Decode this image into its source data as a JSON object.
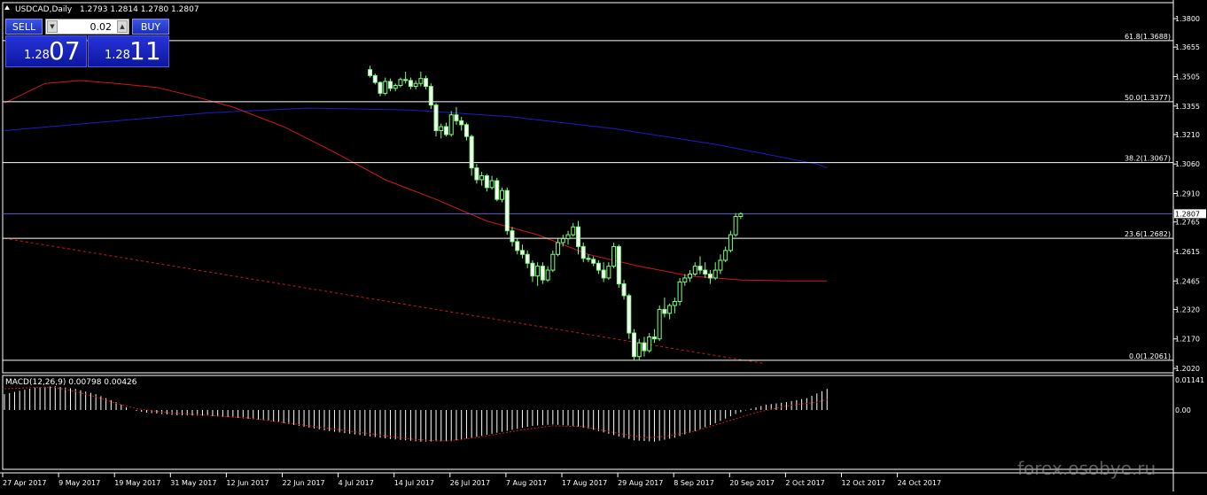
{
  "header": {
    "symbol": "USDCAD,Daily",
    "ohlc": "1.2793 1.2814 1.2780 1.2807"
  },
  "trade_panel": {
    "sell_label": "SELL",
    "buy_label": "BUY",
    "lot": "0.02",
    "sell_prefix": "1.28",
    "sell_big": "07",
    "buy_prefix": "1.28",
    "buy_big": "11"
  },
  "colors": {
    "background": "#000000",
    "candle": "#7fff7f",
    "ma_fast": "#d01818",
    "ma_slow": "#1c1cc8",
    "fib": "#ffffff",
    "bid_line": "#5c5cc8",
    "macd_hist": "#ffffff",
    "macd_signal": "#d01818",
    "bid_label_bg": "#ffffff",
    "watermark": "#9a9a9a"
  },
  "watermark": "forex.osobye.ru",
  "chart_data": [
    {
      "type": "candlestick",
      "title": "USDCAD,Daily",
      "y_ticks": [
        "1.3800",
        "1.3655",
        "1.3505",
        "1.3355",
        "1.3210",
        "1.3060",
        "1.2910",
        "1.2765",
        "1.2615",
        "1.2465",
        "1.2320",
        "1.2170",
        "1.2020"
      ],
      "ylim": [
        1.202,
        1.38
      ],
      "x_tick_labels": [
        "27 Apr 2017",
        "9 May 2017",
        "19 May 2017",
        "31 May 2017",
        "12 Jun 2017",
        "22 Jun 2017",
        "4 Jul 2017",
        "14 Jul 2017",
        "26 Jul 2017",
        "7 Aug 2017",
        "17 Aug 2017",
        "29 Aug 2017",
        "8 Sep 2017",
        "20 Sep 2017",
        "2 Oct 2017",
        "12 Oct 2017",
        "24 Oct 2017"
      ],
      "current_price": "1.2807",
      "fibonacci": [
        {
          "label": "61.8(1.3688)",
          "value": 1.3688
        },
        {
          "label": "50.0(1.3377)",
          "value": 1.3377
        },
        {
          "label": "38.2(1.3067)",
          "value": 1.3067
        },
        {
          "label": "23.6(1.2682)",
          "value": 1.2682
        },
        {
          "label": "0.0(1.2061)",
          "value": 1.2061
        }
      ],
      "trendline": {
        "from": [
          0,
          1.2682
        ],
        "to": [
          97,
          1.2055
        ]
      },
      "candles": [
        [
          1.354,
          1.356,
          1.35,
          1.351
        ],
        [
          1.351,
          1.352,
          1.3465,
          1.3475
        ],
        [
          1.3475,
          1.348,
          1.3405,
          1.342
        ],
        [
          1.342,
          1.35,
          1.341,
          1.348
        ],
        [
          1.348,
          1.3495,
          1.343,
          1.3445
        ],
        [
          1.3445,
          1.347,
          1.343,
          1.346
        ],
        [
          1.346,
          1.35,
          1.345,
          1.349
        ],
        [
          1.349,
          1.353,
          1.347,
          1.3485
        ],
        [
          1.3485,
          1.35,
          1.344,
          1.3455
        ],
        [
          1.3455,
          1.3485,
          1.344,
          1.347
        ],
        [
          1.347,
          1.353,
          1.3455,
          1.3495
        ],
        [
          1.3495,
          1.351,
          1.344,
          1.3455
        ],
        [
          1.3455,
          1.347,
          1.334,
          1.336
        ],
        [
          1.336,
          1.337,
          1.32,
          1.323
        ],
        [
          1.323,
          1.3265,
          1.319,
          1.325
        ],
        [
          1.325,
          1.327,
          1.32,
          1.321
        ],
        [
          1.321,
          1.333,
          1.32,
          1.331
        ],
        [
          1.331,
          1.335,
          1.326,
          1.328
        ],
        [
          1.328,
          1.33,
          1.323,
          1.326
        ],
        [
          1.326,
          1.327,
          1.318,
          1.32
        ],
        [
          1.32,
          1.321,
          1.3,
          1.304
        ],
        [
          1.304,
          1.306,
          1.296,
          1.298
        ],
        [
          1.298,
          1.302,
          1.295,
          1.3
        ],
        [
          1.3,
          1.301,
          1.292,
          1.294
        ],
        [
          1.294,
          1.3,
          1.293,
          1.2975
        ],
        [
          1.2975,
          1.299,
          1.287,
          1.288
        ],
        [
          1.288,
          1.294,
          1.2865,
          1.2925
        ],
        [
          1.2925,
          1.294,
          1.27,
          1.272
        ],
        [
          1.272,
          1.274,
          1.264,
          1.2665
        ],
        [
          1.2665,
          1.268,
          1.26,
          1.262
        ],
        [
          1.262,
          1.265,
          1.258,
          1.26
        ],
        [
          1.26,
          1.262,
          1.253,
          1.2555
        ],
        [
          1.2555,
          1.257,
          1.246,
          1.249
        ],
        [
          1.249,
          1.256,
          1.244,
          1.254
        ],
        [
          1.254,
          1.256,
          1.245,
          1.247
        ],
        [
          1.247,
          1.254,
          1.246,
          1.252
        ],
        [
          1.252,
          1.262,
          1.251,
          1.26
        ],
        [
          1.26,
          1.268,
          1.259,
          1.266
        ],
        [
          1.266,
          1.27,
          1.264,
          1.268
        ],
        [
          1.268,
          1.272,
          1.265,
          1.27
        ],
        [
          1.27,
          1.276,
          1.269,
          1.274
        ],
        [
          1.274,
          1.277,
          1.26,
          1.264
        ],
        [
          1.264,
          1.266,
          1.256,
          1.258
        ],
        [
          1.258,
          1.26,
          1.256,
          1.2575
        ],
        [
          1.2575,
          1.259,
          1.254,
          1.2555
        ],
        [
          1.2555,
          1.257,
          1.25,
          1.252
        ],
        [
          1.252,
          1.256,
          1.246,
          1.248
        ],
        [
          1.248,
          1.256,
          1.247,
          1.254
        ],
        [
          1.254,
          1.266,
          1.253,
          1.264
        ],
        [
          1.264,
          1.265,
          1.243,
          1.245
        ],
        [
          1.245,
          1.247,
          1.237,
          1.239
        ],
        [
          1.239,
          1.24,
          1.217,
          1.22
        ],
        [
          1.22,
          1.222,
          1.206,
          1.208
        ],
        [
          1.208,
          1.217,
          1.206,
          1.215
        ],
        [
          1.215,
          1.218,
          1.208,
          1.211
        ],
        [
          1.211,
          1.22,
          1.21,
          1.218
        ],
        [
          1.218,
          1.222,
          1.215,
          1.217
        ],
        [
          1.217,
          1.234,
          1.216,
          1.232
        ],
        [
          1.232,
          1.238,
          1.228,
          1.23
        ],
        [
          1.23,
          1.235,
          1.227,
          1.234
        ],
        [
          1.234,
          1.238,
          1.23,
          1.236
        ],
        [
          1.236,
          1.248,
          1.234,
          1.246
        ],
        [
          1.246,
          1.25,
          1.244,
          1.248
        ],
        [
          1.248,
          1.252,
          1.246,
          1.25
        ],
        [
          1.25,
          1.256,
          1.249,
          1.254
        ],
        [
          1.254,
          1.259,
          1.25,
          1.252
        ],
        [
          1.252,
          1.256,
          1.248,
          1.25
        ],
        [
          1.25,
          1.252,
          1.245,
          1.248
        ],
        [
          1.248,
          1.256,
          1.247,
          1.252
        ],
        [
          1.252,
          1.26,
          1.25,
          1.257
        ],
        [
          1.257,
          1.264,
          1.256,
          1.262
        ],
        [
          1.262,
          1.272,
          1.261,
          1.27
        ],
        [
          1.27,
          1.281,
          1.269,
          1.2793
        ],
        [
          1.2793,
          1.2814,
          1.278,
          1.2807
        ]
      ],
      "ma_fast": [
        [
          0,
          1.337
        ],
        [
          8,
          1.347
        ],
        [
          15,
          1.3485
        ],
        [
          22,
          1.347
        ],
        [
          30,
          1.345
        ],
        [
          38,
          1.34
        ],
        [
          45,
          1.335
        ],
        [
          55,
          1.325
        ],
        [
          65,
          1.312
        ],
        [
          75,
          1.298
        ],
        [
          85,
          1.288
        ],
        [
          95,
          1.277
        ],
        [
          105,
          1.27
        ],
        [
          115,
          1.26
        ],
        [
          125,
          1.254
        ],
        [
          135,
          1.249
        ],
        [
          145,
          1.247
        ],
        [
          155,
          1.2465
        ],
        [
          162,
          1.2465
        ]
      ],
      "ma_slow": [
        [
          0,
          1.323
        ],
        [
          20,
          1.3275
        ],
        [
          40,
          1.332
        ],
        [
          60,
          1.3345
        ],
        [
          80,
          1.3335
        ],
        [
          100,
          1.33
        ],
        [
          120,
          1.324
        ],
        [
          140,
          1.316
        ],
        [
          160,
          1.306
        ],
        [
          162,
          1.304
        ]
      ]
    },
    {
      "type": "bar",
      "title": "MACD(12,26,9) 0.00798 0.00426",
      "y_ticks": [
        "0.01141",
        "0.00"
      ],
      "ylim": [
        -0.0135,
        0.0114
      ],
      "histogram": [
        [
          0,
          0.006
        ],
        [
          6,
          0.0085
        ],
        [
          10,
          0.009
        ],
        [
          14,
          0.008
        ],
        [
          18,
          0.006
        ],
        [
          22,
          0.003
        ],
        [
          25,
          0.0
        ],
        [
          28,
          -0.001
        ],
        [
          34,
          -0.002
        ],
        [
          40,
          -0.0022
        ],
        [
          46,
          -0.003
        ],
        [
          52,
          -0.004
        ],
        [
          58,
          -0.006
        ],
        [
          64,
          -0.008
        ],
        [
          70,
          -0.0095
        ],
        [
          76,
          -0.011
        ],
        [
          82,
          -0.012
        ],
        [
          88,
          -0.0118
        ],
        [
          92,
          -0.0105
        ],
        [
          96,
          -0.009
        ],
        [
          100,
          -0.0075
        ],
        [
          104,
          -0.006
        ],
        [
          108,
          -0.0055
        ],
        [
          112,
          -0.006
        ],
        [
          116,
          -0.0075
        ],
        [
          120,
          -0.0095
        ],
        [
          124,
          -0.0115
        ],
        [
          128,
          -0.012
        ],
        [
          132,
          -0.0105
        ],
        [
          136,
          -0.008
        ],
        [
          140,
          -0.005
        ],
        [
          144,
          -0.0015
        ],
        [
          147,
          0.0005
        ],
        [
          150,
          0.002
        ],
        [
          154,
          0.003
        ],
        [
          158,
          0.0045
        ],
        [
          162,
          0.008
        ]
      ],
      "signal": [
        [
          0,
          0.008
        ],
        [
          6,
          0.0085
        ],
        [
          10,
          0.0085
        ],
        [
          14,
          0.007
        ],
        [
          18,
          0.005
        ],
        [
          22,
          0.0025
        ],
        [
          26,
          0.0005
        ],
        [
          32,
          -0.001
        ],
        [
          40,
          -0.002
        ],
        [
          48,
          -0.003
        ],
        [
          56,
          -0.005
        ],
        [
          64,
          -0.007
        ],
        [
          72,
          -0.009
        ],
        [
          80,
          -0.011
        ],
        [
          86,
          -0.0118
        ],
        [
          90,
          -0.0112
        ],
        [
          96,
          -0.0095
        ],
        [
          102,
          -0.0075
        ],
        [
          108,
          -0.006
        ],
        [
          114,
          -0.0063
        ],
        [
          120,
          -0.0085
        ],
        [
          126,
          -0.0105
        ],
        [
          130,
          -0.01
        ],
        [
          136,
          -0.008
        ],
        [
          142,
          -0.0045
        ],
        [
          148,
          -0.001
        ],
        [
          154,
          0.0015
        ],
        [
          160,
          0.003
        ],
        [
          162,
          0.004
        ]
      ]
    }
  ]
}
